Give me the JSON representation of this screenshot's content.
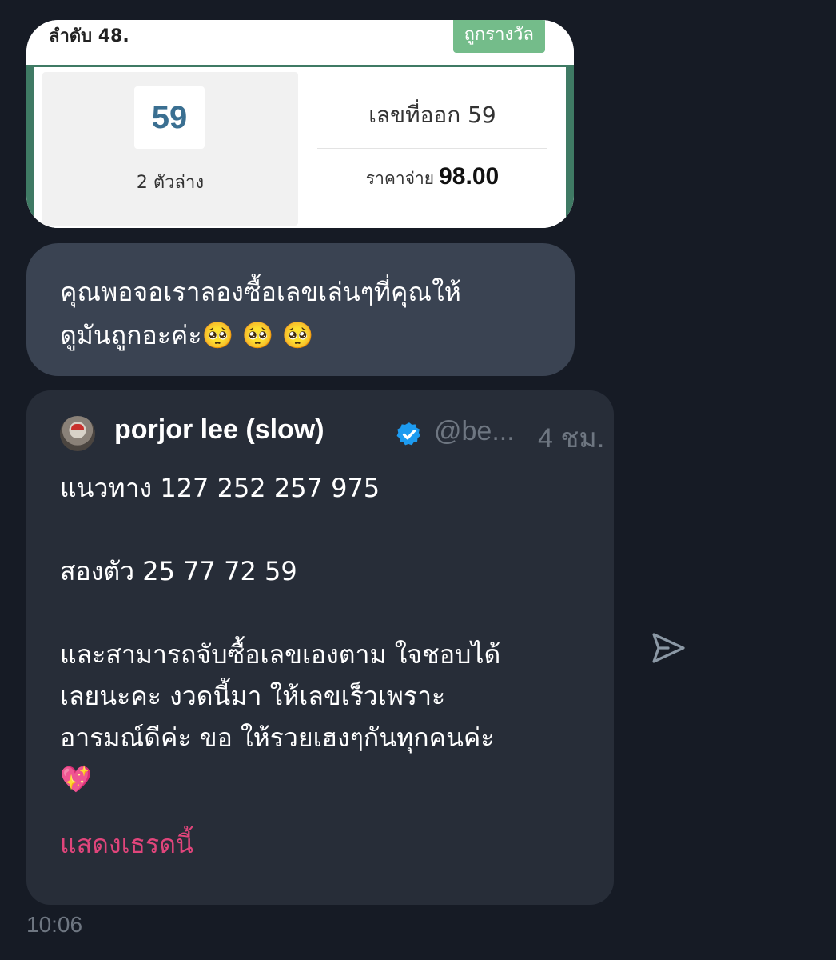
{
  "lottery_card": {
    "rank": "ลำดับ 48.",
    "status": "ถูกรางวัล",
    "number": "59",
    "type": "2 ตัวล่าง",
    "result": "เลขที่ออก 59",
    "payout_label": "ราคาจ่าย",
    "payout_value": "98.00"
  },
  "message": {
    "line1": "คุณพอจอเราลองซื้อเลขเล่นๆที่คุณให้",
    "line2": "ดูมันถูกอะค่ะ🥺 🥺 🥺"
  },
  "quote": {
    "author_name": "porjor lee (slow)",
    "handle": "@be...",
    "time": "4 ชม.",
    "para1": "แนวทาง 127 252 257 975",
    "para2": "สองตัว 25 77 72 59",
    "para3": "และสามารถจับซื้อเลขเองตาม ใจชอบได้\nเลยนะคะ งวดนี้มา ให้เลขเร็วเพราะ\nอารมณ์ดีค่ะ ขอ ให้รวยเฮงๆกันทุกคนค่ะ\n💖",
    "show_thread": "แสดงเธรดนี้"
  },
  "timestamp": "10:06",
  "icons": {
    "verified": "verified-badge-icon",
    "share": "send-icon"
  },
  "colors": {
    "background": "#161b25",
    "bubble": "#3a4352",
    "quote_card": "#272d38",
    "accent_link": "#e0457b",
    "verified": "#1d9bf0",
    "lottery_green": "#74bc8a"
  }
}
